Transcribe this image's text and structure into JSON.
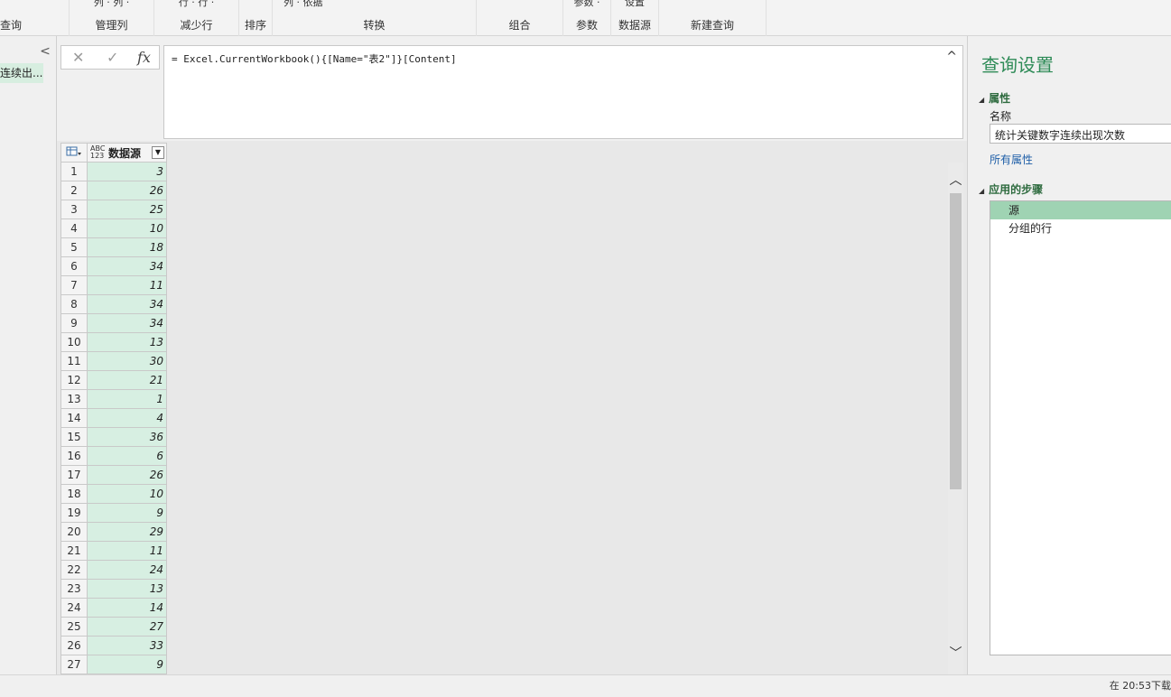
{
  "ribbon": {
    "groups": [
      {
        "top": "",
        "label": "查询"
      },
      {
        "top": "列 ·  列 ·",
        "label": "管理列"
      },
      {
        "top": "行 ·  行 ·",
        "label": "减少行"
      },
      {
        "top": "",
        "label": "排序"
      },
      {
        "top": "列 ·   依据",
        "label": "转换"
      },
      {
        "top": "",
        "label": "组合"
      },
      {
        "top": "参数 ·",
        "label": "参数"
      },
      {
        "top": "设置",
        "label": "数据源"
      },
      {
        "top": "",
        "label": "新建查询"
      }
    ]
  },
  "queries": {
    "collapse": "<",
    "items": [
      {
        "label": "连续出..."
      }
    ]
  },
  "formula_bar": {
    "cancel": "✕",
    "confirm": "✓",
    "fx": "fx",
    "formula": "= Excel.CurrentWorkbook(){[Name=\"表2\"]}[Content]",
    "expand": "^"
  },
  "grid": {
    "type_icon": "ABC 123",
    "column": "数据源",
    "rows": [
      {
        "n": "1",
        "v": "3"
      },
      {
        "n": "2",
        "v": "26"
      },
      {
        "n": "3",
        "v": "25"
      },
      {
        "n": "4",
        "v": "10"
      },
      {
        "n": "5",
        "v": "18"
      },
      {
        "n": "6",
        "v": "34"
      },
      {
        "n": "7",
        "v": "11"
      },
      {
        "n": "8",
        "v": "34"
      },
      {
        "n": "9",
        "v": "34"
      },
      {
        "n": "10",
        "v": "13"
      },
      {
        "n": "11",
        "v": "30"
      },
      {
        "n": "12",
        "v": "21"
      },
      {
        "n": "13",
        "v": "1"
      },
      {
        "n": "14",
        "v": "4"
      },
      {
        "n": "15",
        "v": "36"
      },
      {
        "n": "16",
        "v": "6"
      },
      {
        "n": "17",
        "v": "26"
      },
      {
        "n": "18",
        "v": "10"
      },
      {
        "n": "19",
        "v": "9"
      },
      {
        "n": "20",
        "v": "29"
      },
      {
        "n": "21",
        "v": "11"
      },
      {
        "n": "22",
        "v": "24"
      },
      {
        "n": "23",
        "v": "13"
      },
      {
        "n": "24",
        "v": "14"
      },
      {
        "n": "25",
        "v": "27"
      },
      {
        "n": "26",
        "v": "33"
      },
      {
        "n": "27",
        "v": "9"
      }
    ]
  },
  "settings": {
    "title": "查询设置",
    "properties_header": "属性",
    "name_label": "名称",
    "name_value": "统计关键数字连续出现次数",
    "all_properties": "所有属性",
    "steps_header": "应用的步骤",
    "steps": [
      {
        "label": "源"
      },
      {
        "label": "分组的行"
      }
    ]
  },
  "status": {
    "right": "在 20:53下载"
  }
}
